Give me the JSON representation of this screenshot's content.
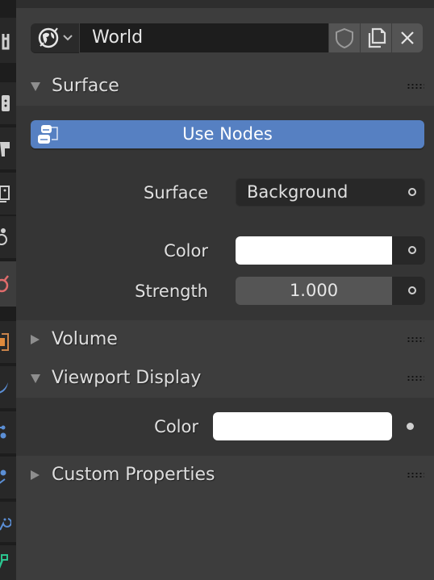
{
  "properties_tabs": [
    {
      "name": "tool",
      "icon": "wrench-icon",
      "color": "#cfcfcf",
      "active": false
    },
    {
      "name": "render",
      "icon": "render-icon",
      "color": "#cfcfcf",
      "active": false
    },
    {
      "name": "output",
      "icon": "printer-icon",
      "color": "#cfcfcf",
      "active": false
    },
    {
      "name": "view-layer",
      "icon": "image-icon",
      "color": "#cfcfcf",
      "active": false
    },
    {
      "name": "scene",
      "icon": "scene-icon",
      "color": "#cfcfcf",
      "active": false
    },
    {
      "name": "world",
      "icon": "world-icon",
      "color": "#e06c6c",
      "active": true
    },
    {
      "name": "object",
      "icon": "object-icon",
      "color": "#e08a3c",
      "active": false
    },
    {
      "name": "modifiers",
      "icon": "wrench-blue-icon",
      "color": "#5b8fd6",
      "active": false
    },
    {
      "name": "particles",
      "icon": "particles-icon",
      "color": "#5b8fd6",
      "active": false
    },
    {
      "name": "physics",
      "icon": "physics-icon",
      "color": "#5b8fd6",
      "active": false
    },
    {
      "name": "constraints",
      "icon": "constraint-icon",
      "color": "#5b8fd6",
      "active": false
    },
    {
      "name": "data",
      "icon": "data-icon",
      "color": "#2bc48f",
      "active": false
    }
  ],
  "id_block": {
    "type_icon": "world-icon",
    "name": "World",
    "buttons": [
      "fake-user-shield",
      "duplicate",
      "unlink"
    ]
  },
  "panels": {
    "surface": {
      "title": "Surface",
      "expanded": true,
      "use_nodes_label": "Use Nodes",
      "surface_label": "Surface",
      "surface_value": "Background",
      "color_label": "Color",
      "color_value": "#ffffff",
      "strength_label": "Strength",
      "strength_value": "1.000"
    },
    "volume": {
      "title": "Volume",
      "expanded": false
    },
    "viewport_display": {
      "title": "Viewport Display",
      "expanded": true,
      "color_label": "Color",
      "color_value": "#ffffff"
    },
    "custom_properties": {
      "title": "Custom Properties",
      "expanded": false
    }
  },
  "colors": {
    "accent": "#5680c2",
    "background": "#3d3d3d",
    "panel_body": "#353535"
  }
}
